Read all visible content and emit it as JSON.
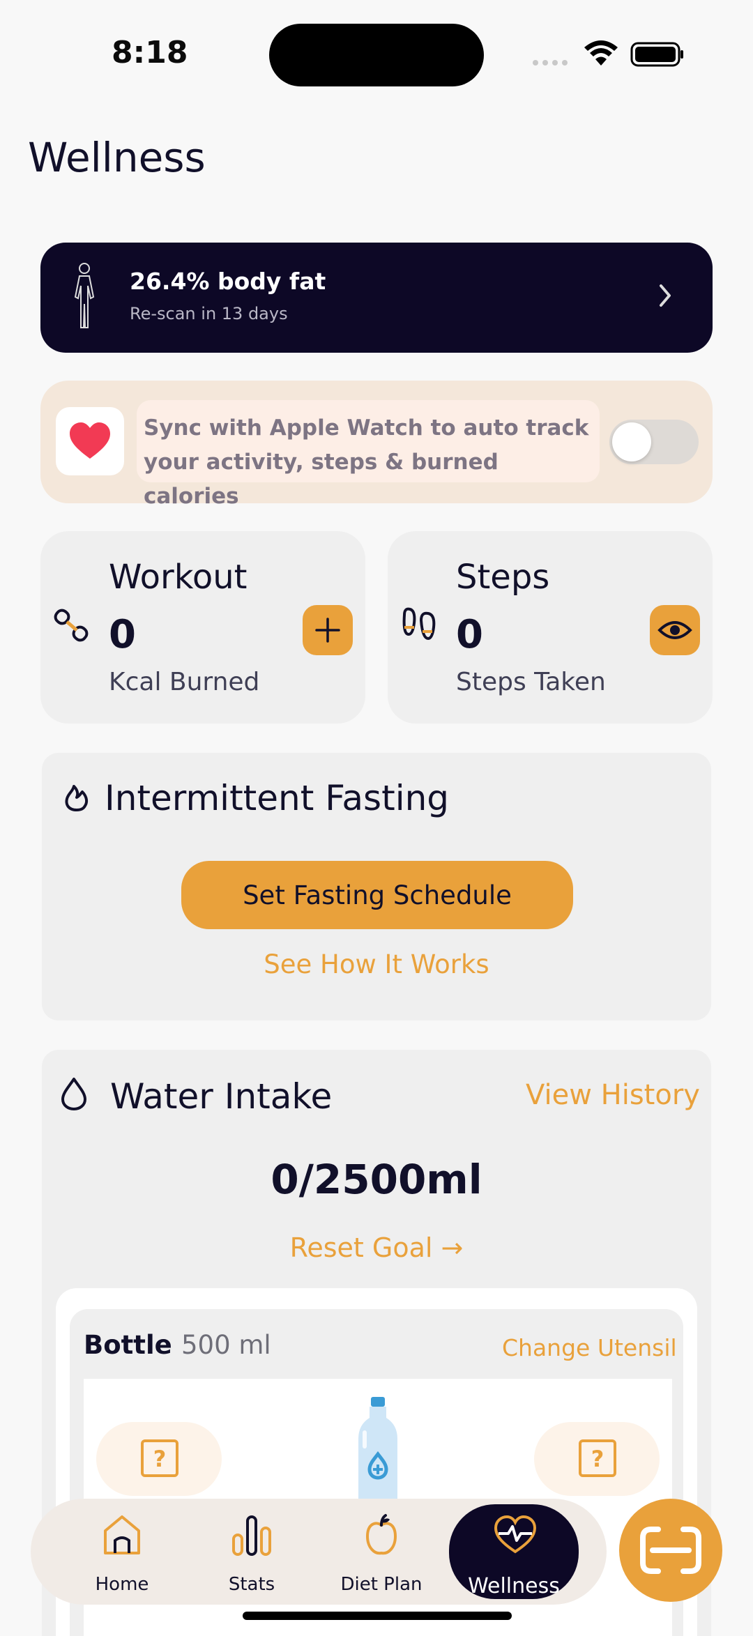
{
  "status_bar": {
    "time": "8:18"
  },
  "page": {
    "title": "Wellness"
  },
  "body_fat": {
    "title": "26.4% body fat",
    "subtitle": "Re-scan in 13 days"
  },
  "sync": {
    "message": "Sync with Apple Watch to auto track your activity, steps & burned calories",
    "enabled": false
  },
  "workout": {
    "label": "Workout",
    "value": "0",
    "unit": "Kcal Burned"
  },
  "steps": {
    "label": "Steps",
    "value": "0",
    "unit": "Steps Taken"
  },
  "fasting": {
    "title": "Intermittent Fasting",
    "cta": "Set Fasting Schedule",
    "link": "See How It Works"
  },
  "water": {
    "title": "Water Intake",
    "history": "View History",
    "amount": "0/2500ml",
    "reset": "Reset Goal →",
    "utensil": {
      "name": "Bottle",
      "size": "500 ml",
      "change": "Change Utensil"
    }
  },
  "nav": {
    "items": [
      {
        "label": "Home",
        "icon": "home-icon"
      },
      {
        "label": "Stats",
        "icon": "stats-icon"
      },
      {
        "label": "Diet Plan",
        "icon": "apple-icon"
      },
      {
        "label": "Wellness",
        "icon": "heart-pulse-icon",
        "active": true
      }
    ]
  },
  "colors": {
    "accent": "#e9a13b",
    "dark": "#0d0826",
    "card": "#efefef",
    "sync_bg": "#f4e7da"
  }
}
